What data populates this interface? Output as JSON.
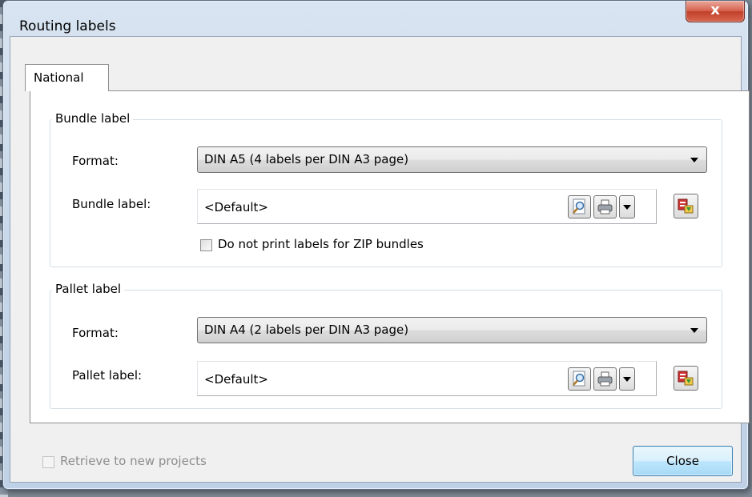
{
  "window": {
    "title": "Routing labels",
    "close_glyph": "x"
  },
  "tabs": [
    {
      "label": "National"
    }
  ],
  "bundle_group": {
    "title": "Bundle label",
    "format_label": "Format:",
    "format_value": "DIN A5 (4 labels per DIN A3 page)",
    "label_field_label": "Bundle label:",
    "label_field_value": "<Default>",
    "zip_checkbox_label": "Do not print labels for ZIP bundles",
    "zip_checkbox_checked": false
  },
  "pallet_group": {
    "title": "Pallet label",
    "format_label": "Format:",
    "format_value": "DIN A4 (2 labels per DIN A3 page)",
    "label_field_label": "Pallet label:",
    "label_field_value": "<Default>"
  },
  "footer": {
    "retrieve_checkbox_label": "Retrieve to new projects",
    "retrieve_checkbox_checked": false,
    "retrieve_checkbox_enabled": false,
    "close_button_label": "Close"
  },
  "icons": {
    "preview": "magnifier-preview-icon",
    "print": "printer-icon",
    "dropdown": "chevron-down-icon",
    "edit_layout": "label-layout-edit-icon"
  }
}
